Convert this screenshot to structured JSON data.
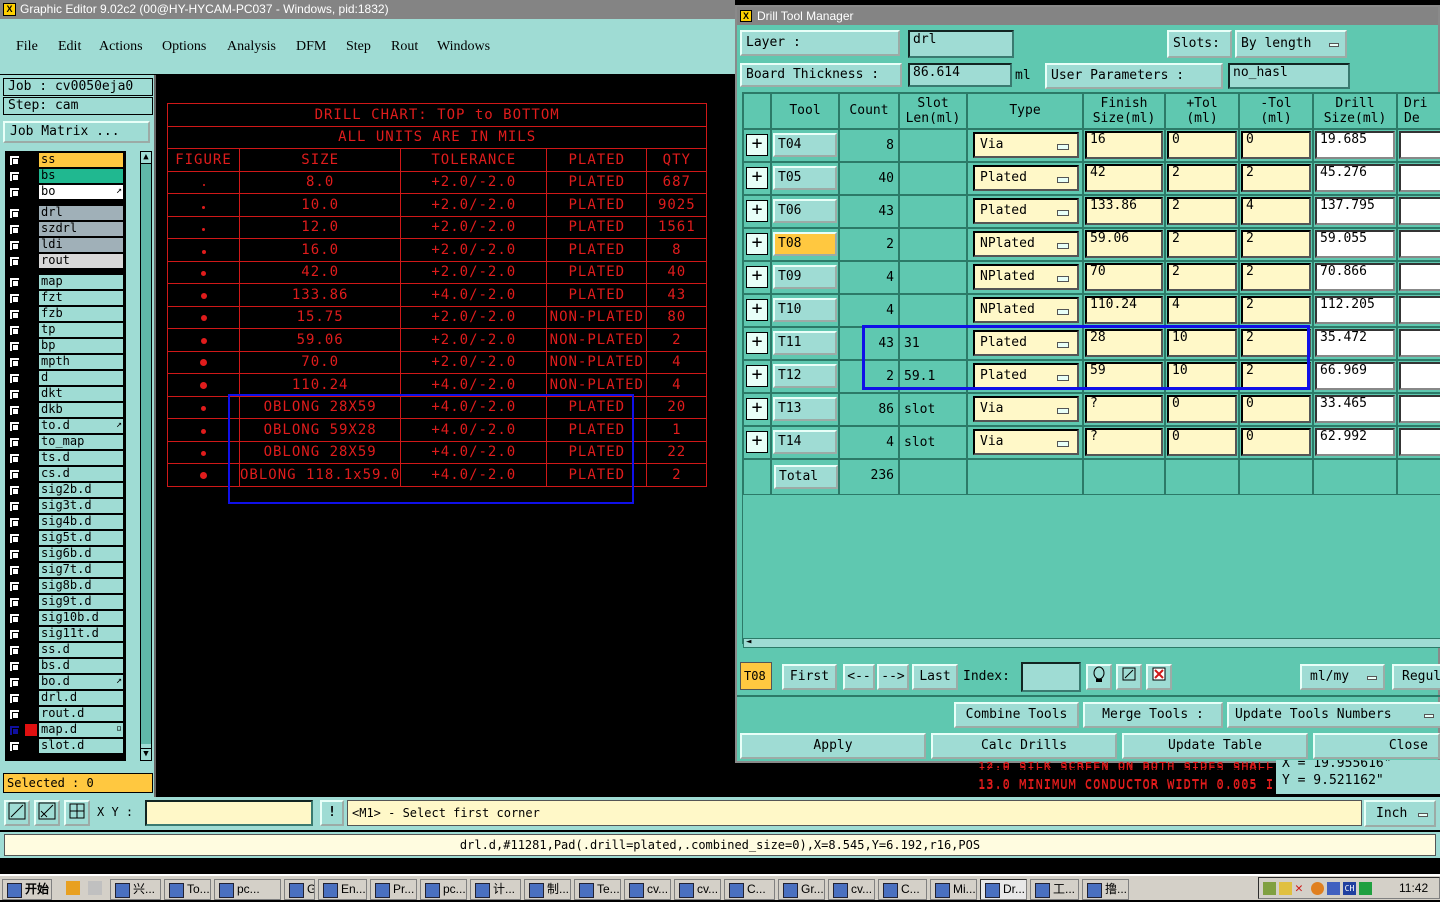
{
  "main_window": {
    "title": "Graphic Editor 9.02c2 (00@HY-HYCAM-PC037 - Windows, pid:1832)",
    "menu": [
      "File",
      "Edit",
      "Actions",
      "Options",
      "Analysis",
      "DFM",
      "Step",
      "Rout",
      "Windows"
    ]
  },
  "left_panel": {
    "job": "Job : cv0050eja0",
    "step": "Step: cam",
    "job_matrix": "Job Matrix ...",
    "layers": [
      {
        "name": "ss",
        "color": "#ffc840"
      },
      {
        "name": "bs",
        "color": "#20b890"
      },
      {
        "name": "bo",
        "color": "#ffffff",
        "arrow": "↗"
      },
      {
        "name": "drl",
        "color": "#a0b0b8"
      },
      {
        "name": "szdrl",
        "color": "#a0b0b8"
      },
      {
        "name": "ldi",
        "color": "#a0b0b8"
      },
      {
        "name": "rout",
        "color": "#d8d8d8"
      },
      {
        "name": "map",
        "color": "#9fdcd4"
      },
      {
        "name": "fzt",
        "color": "#9fdcd4"
      },
      {
        "name": "fzb",
        "color": "#9fdcd4"
      },
      {
        "name": "tp",
        "color": "#9fdcd4"
      },
      {
        "name": "bp",
        "color": "#9fdcd4"
      },
      {
        "name": "mpth",
        "color": "#9fdcd4"
      },
      {
        "name": "d",
        "color": "#9fdcd4"
      },
      {
        "name": "dkt",
        "color": "#9fdcd4"
      },
      {
        "name": "dkb",
        "color": "#9fdcd4"
      },
      {
        "name": "to.d",
        "color": "#9fdcd4",
        "arrow": "↗"
      },
      {
        "name": "to_map",
        "color": "#9fdcd4"
      },
      {
        "name": "ts.d",
        "color": "#9fdcd4"
      },
      {
        "name": "cs.d",
        "color": "#9fdcd4"
      },
      {
        "name": "sig2b.d",
        "color": "#9fdcd4"
      },
      {
        "name": "sig3t.d",
        "color": "#9fdcd4"
      },
      {
        "name": "sig4b.d",
        "color": "#9fdcd4"
      },
      {
        "name": "sig5t.d",
        "color": "#9fdcd4"
      },
      {
        "name": "sig6b.d",
        "color": "#9fdcd4"
      },
      {
        "name": "sig7t.d",
        "color": "#9fdcd4"
      },
      {
        "name": "sig8b.d",
        "color": "#9fdcd4"
      },
      {
        "name": "sig9t.d",
        "color": "#9fdcd4"
      },
      {
        "name": "sig10b.d",
        "color": "#9fdcd4"
      },
      {
        "name": "sig11t.d",
        "color": "#9fdcd4"
      },
      {
        "name": "ss.d",
        "color": "#9fdcd4"
      },
      {
        "name": "bs.d",
        "color": "#9fdcd4"
      },
      {
        "name": "bo.d",
        "color": "#9fdcd4",
        "arrow": "↗"
      },
      {
        "name": "drl.d",
        "color": "#9fdcd4"
      },
      {
        "name": "rout.d",
        "color": "#9fdcd4"
      },
      {
        "name": "map.d",
        "color": "#9fdcd4",
        "active": true,
        "arrow": "▫"
      },
      {
        "name": "slot.d",
        "color": "#9fdcd4"
      }
    ],
    "selected": "Selected : 0"
  },
  "drill_chart": {
    "title1": "DRILL CHART: TOP to BOTTOM",
    "title2": "ALL UNITS ARE IN MILS",
    "headers": [
      "FIGURE",
      "SIZE",
      "TOLERANCE",
      "PLATED",
      "QTY"
    ],
    "rows": [
      {
        "fig": 2,
        "size": "8.0",
        "tol": "+2.0/-2.0",
        "plated": "PLATED",
        "qty": "687"
      },
      {
        "fig": 3,
        "size": "10.0",
        "tol": "+2.0/-2.0",
        "plated": "PLATED",
        "qty": "9025"
      },
      {
        "fig": 3,
        "size": "12.0",
        "tol": "+2.0/-2.0",
        "plated": "PLATED",
        "qty": "1561"
      },
      {
        "fig": 4,
        "size": "16.0",
        "tol": "+2.0/-2.0",
        "plated": "PLATED",
        "qty": "8"
      },
      {
        "fig": 5,
        "size": "42.0",
        "tol": "+2.0/-2.0",
        "plated": "PLATED",
        "qty": "40"
      },
      {
        "fig": 6,
        "size": "133.86",
        "tol": "+4.0/-2.0",
        "plated": "PLATED",
        "qty": "43"
      },
      {
        "fig": 6,
        "size": "15.75",
        "tol": "+2.0/-2.0",
        "plated": "NON-PLATED",
        "qty": "80"
      },
      {
        "fig": 6,
        "size": "59.06",
        "tol": "+2.0/-2.0",
        "plated": "NON-PLATED",
        "qty": "2"
      },
      {
        "fig": 7,
        "size": "70.0",
        "tol": "+2.0/-2.0",
        "plated": "NON-PLATED",
        "qty": "4"
      },
      {
        "fig": 7,
        "size": "110.24",
        "tol": "+4.0/-2.0",
        "plated": "NON-PLATED",
        "qty": "4"
      },
      {
        "fig": 5,
        "size": "OBLONG 28X59",
        "tol": "+4.0/-2.0",
        "plated": "PLATED",
        "qty": "20"
      },
      {
        "fig": 5,
        "size": "OBLONG 59X28",
        "tol": "+4.0/-2.0",
        "plated": "PLATED",
        "qty": "1"
      },
      {
        "fig": 5,
        "size": "OBLONG 28X59",
        "tol": "+4.0/-2.0",
        "plated": "PLATED",
        "qty": "22"
      },
      {
        "fig": 7,
        "size": "OBLONG 118.1x59.0",
        "tol": "+4.0/-2.0",
        "plated": "PLATED",
        "qty": "2"
      }
    ]
  },
  "drill_tool_manager": {
    "title": "Drill Tool Manager",
    "layer_label": "Layer :",
    "layer_value": "drl",
    "slots_label": "Slots:",
    "slots_value": "By length",
    "board_thickness_label": "Board Thickness :",
    "board_thickness_value": "86.614",
    "board_thickness_unit": "ml",
    "user_params_label": "User Parameters :",
    "user_params_value": "no_hasl",
    "headers": {
      "tool": "Tool",
      "count": "Count",
      "slot1": "Slot",
      "slot2": "Len(ml)",
      "type": "Type",
      "finish1": "Finish",
      "finish2": "Size(ml)",
      "ptol1": "+Tol",
      "ptol2": "(ml)",
      "mtol1": "-Tol",
      "mtol2": "(ml)",
      "drill1": "Drill",
      "drill2": "Size(ml)",
      "dri1": "Dri",
      "dri2": "De"
    },
    "rows": [
      {
        "tool": "T04",
        "count": "8",
        "slot": "",
        "type": "Via",
        "finish": "16",
        "ptol": "0",
        "mtol": "0",
        "drill": "19.685"
      },
      {
        "tool": "T05",
        "count": "40",
        "slot": "",
        "type": "Plated",
        "finish": "42",
        "ptol": "2",
        "mtol": "2",
        "drill": "45.276"
      },
      {
        "tool": "T06",
        "count": "43",
        "slot": "",
        "type": "Plated",
        "finish": "133.86",
        "ptol": "2",
        "mtol": "4",
        "drill": "137.795"
      },
      {
        "tool": "T08",
        "count": "2",
        "slot": "",
        "type": "NPlated",
        "finish": "59.06",
        "ptol": "2",
        "mtol": "2",
        "drill": "59.055",
        "highlight": true
      },
      {
        "tool": "T09",
        "count": "4",
        "slot": "",
        "type": "NPlated",
        "finish": "70",
        "ptol": "2",
        "mtol": "2",
        "drill": "70.866"
      },
      {
        "tool": "T10",
        "count": "4",
        "slot": "",
        "type": "NPlated",
        "finish": "110.24",
        "ptol": "4",
        "mtol": "2",
        "drill": "112.205"
      },
      {
        "tool": "T11",
        "count": "43",
        "slot": "31",
        "type": "Plated",
        "finish": "28",
        "ptol": "10",
        "mtol": "2",
        "drill": "35.472"
      },
      {
        "tool": "T12",
        "count": "2",
        "slot": "59.1",
        "type": "Plated",
        "finish": "59",
        "ptol": "10",
        "mtol": "2",
        "drill": "66.969"
      },
      {
        "tool": "T13",
        "count": "86",
        "slot": "slot",
        "type": "Via",
        "finish": "?",
        "ptol": "0",
        "mtol": "0",
        "drill": "33.465"
      },
      {
        "tool": "T14",
        "count": "4",
        "slot": "slot",
        "type": "Via",
        "finish": "?",
        "ptol": "0",
        "mtol": "0",
        "drill": "62.992"
      }
    ],
    "total_label": "Total",
    "total_count": "236",
    "current_tool": "T08",
    "nav": {
      "first": "First",
      "prev": "<--",
      "next": "-->",
      "last": "Last",
      "index_label": "Index:",
      "units": "ml/my",
      "regul": "Regul"
    },
    "combine_tools": "Combine Tools",
    "merge_tools": "Merge Tools :",
    "update_tools_numbers": "Update Tools Numbers",
    "apply": "Apply",
    "calc_drills": "Calc Drills",
    "update_table": "Update Table",
    "close": "Close"
  },
  "canvas_notes": {
    "line1": "12.0  SILK SCREEN ON BOTH SIDES SHALL",
    "line2": "13.0  MINIMUM CONDUCTOR WIDTH 0.005 I",
    "x": "X = 19.955616\"",
    "y": "Y = 9.521162\""
  },
  "command_bar": {
    "xy_label": "X Y :",
    "prompt": "<M1> - Select first corner",
    "units": "Inch"
  },
  "status_text": "drl.d,#11281,Pad(.drill=plated,.combined_size=0),X=8.545,Y=6.192,r16,POS",
  "taskbar": {
    "start": "开始",
    "tasks": [
      "兴...",
      "To...",
      "pc...",
      "G...",
      "En...",
      "Pr...",
      "pc...",
      "计...",
      "制...",
      "Te...",
      "cv...",
      "cv...",
      "C...",
      "Gr...",
      "cv...",
      "C...",
      "Mi...",
      "Dr...",
      "工...",
      "撸..."
    ],
    "clock": "11:42",
    "lang": "CH"
  }
}
